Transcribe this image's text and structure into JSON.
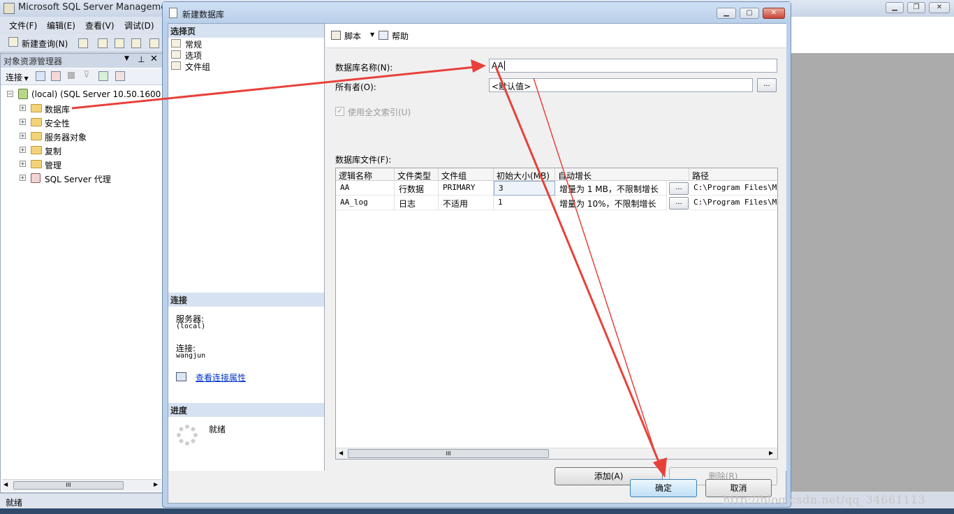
{
  "app": {
    "title": "Microsoft SQL Server Management",
    "menu": [
      "文件(F)",
      "编辑(E)",
      "查看(V)",
      "调试(D)"
    ],
    "toolbar": {
      "new_query": "新建查询(N)"
    },
    "status": "就绪"
  },
  "object_explorer": {
    "title": "对象资源管理器",
    "connect_label": "连接",
    "server_node": "(local) (SQL Server 10.50.1600 -",
    "nodes": [
      "数据库",
      "安全性",
      "服务器对象",
      "复制",
      "管理",
      "SQL Server 代理"
    ],
    "scroll_thumb": "III"
  },
  "dialog": {
    "title": "新建数据库",
    "toolbar": {
      "script": "脚本",
      "help": "帮助"
    },
    "select_page": {
      "header": "选择页",
      "items": [
        "常规",
        "选项",
        "文件组"
      ]
    },
    "connection": {
      "header": "连接",
      "server_label": "服务器:",
      "server_value": "(local)",
      "conn_label": "连接:",
      "conn_value": "wangjun",
      "view_link": "查看连接属性"
    },
    "progress": {
      "header": "进度",
      "status": "就绪"
    },
    "general": {
      "db_name_label": "数据库名称(N):",
      "db_name_value": "AA",
      "owner_label": "所有者(O):",
      "owner_value": "<默认值>",
      "fulltext_label": "使用全文索引(U)",
      "files_label": "数据库文件(F):",
      "ellipsis": "..."
    },
    "files_grid": {
      "columns": [
        "逻辑名称",
        "文件类型",
        "文件组",
        "初始大小(MB)",
        "自动增长",
        "路径"
      ],
      "rows": [
        {
          "name": "AA",
          "type": "行数据",
          "group": "PRIMARY",
          "size": "3",
          "growth": "增量为 1 MB，不限制增长",
          "path": "C:\\Program Files\\Mic"
        },
        {
          "name": "AA_log",
          "type": "日志",
          "group": "不适用",
          "size": "1",
          "growth": "增量为 10%，不限制增长",
          "path": "C:\\Program Files\\Mic"
        }
      ],
      "scroll_thumb": "III"
    },
    "buttons": {
      "add": "添加(A)",
      "remove": "删除(R)",
      "ok": "确定",
      "cancel": "取消"
    }
  },
  "watermark": "http://blog.csdn.net/qq_34661113",
  "colors": {
    "annotation_arrow": "#e8413a",
    "link": "#0033cc",
    "section_header": "#d6e2f1"
  }
}
